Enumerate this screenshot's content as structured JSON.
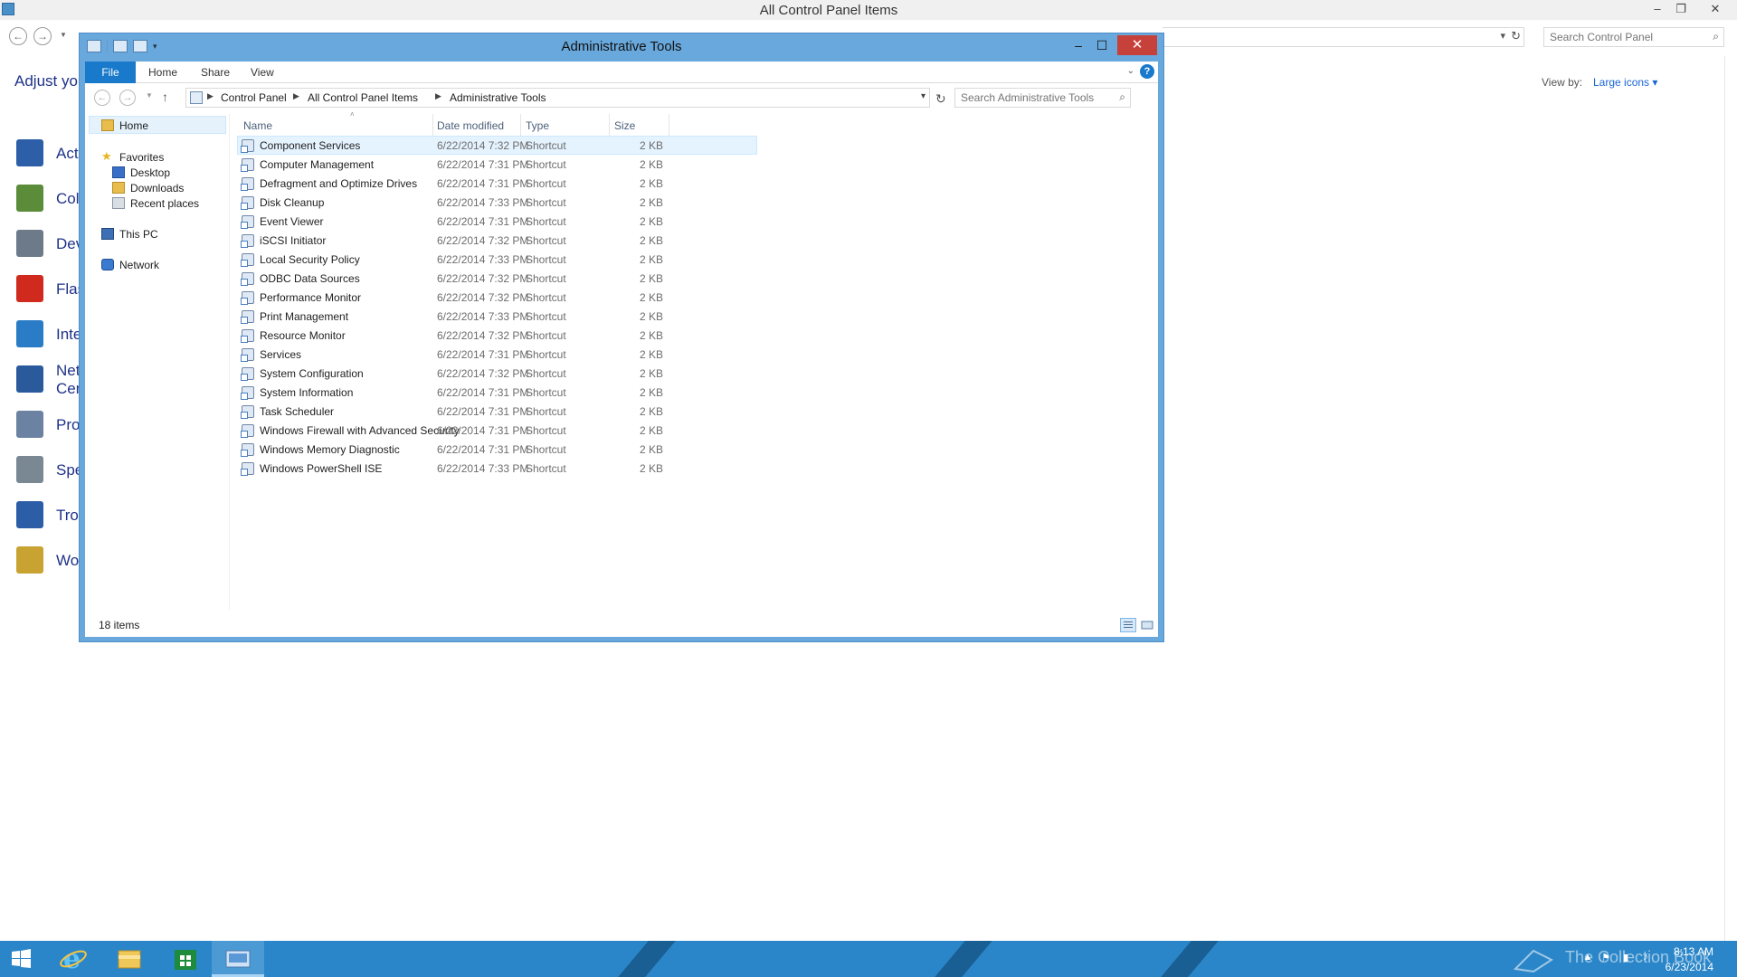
{
  "background_window": {
    "title": "All Control Panel Items",
    "heading": "Adjust you",
    "search_placeholder": "Search Control Panel",
    "view_by_label": "View by:",
    "view_by_value": "Large icons",
    "items": [
      {
        "label": "Acti",
        "icon": "action-center-flag-icon",
        "color": "#2d5fa8"
      },
      {
        "label": "Col",
        "icon": "color-management-icon",
        "color": "#5a8c3a"
      },
      {
        "label": "Dev",
        "icon": "device-manager-icon",
        "color": "#6c7a8a"
      },
      {
        "label": "Flas",
        "icon": "flash-player-icon",
        "color": "#d02a1e"
      },
      {
        "label": "Inte",
        "icon": "internet-options-icon",
        "color": "#2a7cc7"
      },
      {
        "label": "Net",
        "label2": "Cen",
        "icon": "network-sharing-icon",
        "color": "#2b5a9c"
      },
      {
        "label": "Pro",
        "icon": "programs-features-icon",
        "color": "#6b82a2"
      },
      {
        "label": "Spe",
        "icon": "speech-recognition-icon",
        "color": "#7a8894"
      },
      {
        "label": "Tro",
        "icon": "troubleshooting-icon",
        "color": "#2c5ea8"
      },
      {
        "label": "Wo",
        "icon": "work-folders-icon",
        "color": "#c9a332"
      }
    ]
  },
  "window": {
    "title": "Administrative Tools",
    "minimize": "–",
    "maximize": "☐",
    "close": "✕"
  },
  "ribbon": {
    "tabs": [
      "File",
      "Home",
      "Share",
      "View"
    ],
    "help": "?"
  },
  "navigation": {
    "breadcrumbs": [
      "Control Panel",
      "All Control Panel Items",
      "Administrative Tools"
    ],
    "search_placeholder": "Search Administrative Tools"
  },
  "nav_pane": {
    "home": "Home",
    "favorites": "Favorites",
    "favorites_items": [
      "Desktop",
      "Downloads",
      "Recent places"
    ],
    "this_pc": "This PC",
    "network": "Network"
  },
  "columns": [
    "Name",
    "Date modified",
    "Type",
    "Size"
  ],
  "files": [
    {
      "name": "Component Services",
      "date": "6/22/2014 7:32 PM",
      "type": "Shortcut",
      "size": "2 KB"
    },
    {
      "name": "Computer Management",
      "date": "6/22/2014 7:31 PM",
      "type": "Shortcut",
      "size": "2 KB"
    },
    {
      "name": "Defragment and Optimize Drives",
      "date": "6/22/2014 7:31 PM",
      "type": "Shortcut",
      "size": "2 KB"
    },
    {
      "name": "Disk Cleanup",
      "date": "6/22/2014 7:33 PM",
      "type": "Shortcut",
      "size": "2 KB"
    },
    {
      "name": "Event Viewer",
      "date": "6/22/2014 7:31 PM",
      "type": "Shortcut",
      "size": "2 KB"
    },
    {
      "name": "iSCSI Initiator",
      "date": "6/22/2014 7:32 PM",
      "type": "Shortcut",
      "size": "2 KB"
    },
    {
      "name": "Local Security Policy",
      "date": "6/22/2014 7:33 PM",
      "type": "Shortcut",
      "size": "2 KB"
    },
    {
      "name": "ODBC Data Sources",
      "date": "6/22/2014 7:32 PM",
      "type": "Shortcut",
      "size": "2 KB"
    },
    {
      "name": "Performance Monitor",
      "date": "6/22/2014 7:32 PM",
      "type": "Shortcut",
      "size": "2 KB"
    },
    {
      "name": "Print Management",
      "date": "6/22/2014 7:33 PM",
      "type": "Shortcut",
      "size": "2 KB"
    },
    {
      "name": "Resource Monitor",
      "date": "6/22/2014 7:32 PM",
      "type": "Shortcut",
      "size": "2 KB"
    },
    {
      "name": "Services",
      "date": "6/22/2014 7:31 PM",
      "type": "Shortcut",
      "size": "2 KB"
    },
    {
      "name": "System Configuration",
      "date": "6/22/2014 7:32 PM",
      "type": "Shortcut",
      "size": "2 KB"
    },
    {
      "name": "System Information",
      "date": "6/22/2014 7:31 PM",
      "type": "Shortcut",
      "size": "2 KB"
    },
    {
      "name": "Task Scheduler",
      "date": "6/22/2014 7:31 PM",
      "type": "Shortcut",
      "size": "2 KB"
    },
    {
      "name": "Windows Firewall with Advanced Security",
      "date": "6/22/2014 7:31 PM",
      "type": "Shortcut",
      "size": "2 KB"
    },
    {
      "name": "Windows Memory Diagnostic",
      "date": "6/22/2014 7:31 PM",
      "type": "Shortcut",
      "size": "2 KB"
    },
    {
      "name": "Windows PowerShell ISE",
      "date": "6/22/2014 7:33 PM",
      "type": "Shortcut",
      "size": "2 KB"
    }
  ],
  "selected_file": "Component Services",
  "status": {
    "item_count": "18 items"
  },
  "taskbar": {
    "pinned": [
      "windows-start-icon",
      "internet-explorer-icon",
      "file-explorer-icon",
      "store-icon",
      "control-panel-icon"
    ],
    "watermark": "The Collection Book",
    "time": "8:13 AM",
    "date": "6/23/2014"
  },
  "colors": {
    "accent": "#1979ca",
    "window_frame": "#69a8dc",
    "close_button": "#c7413b",
    "selection": "#e5f3ff",
    "taskbar": "#2a86c8",
    "link": "#1e3287"
  }
}
